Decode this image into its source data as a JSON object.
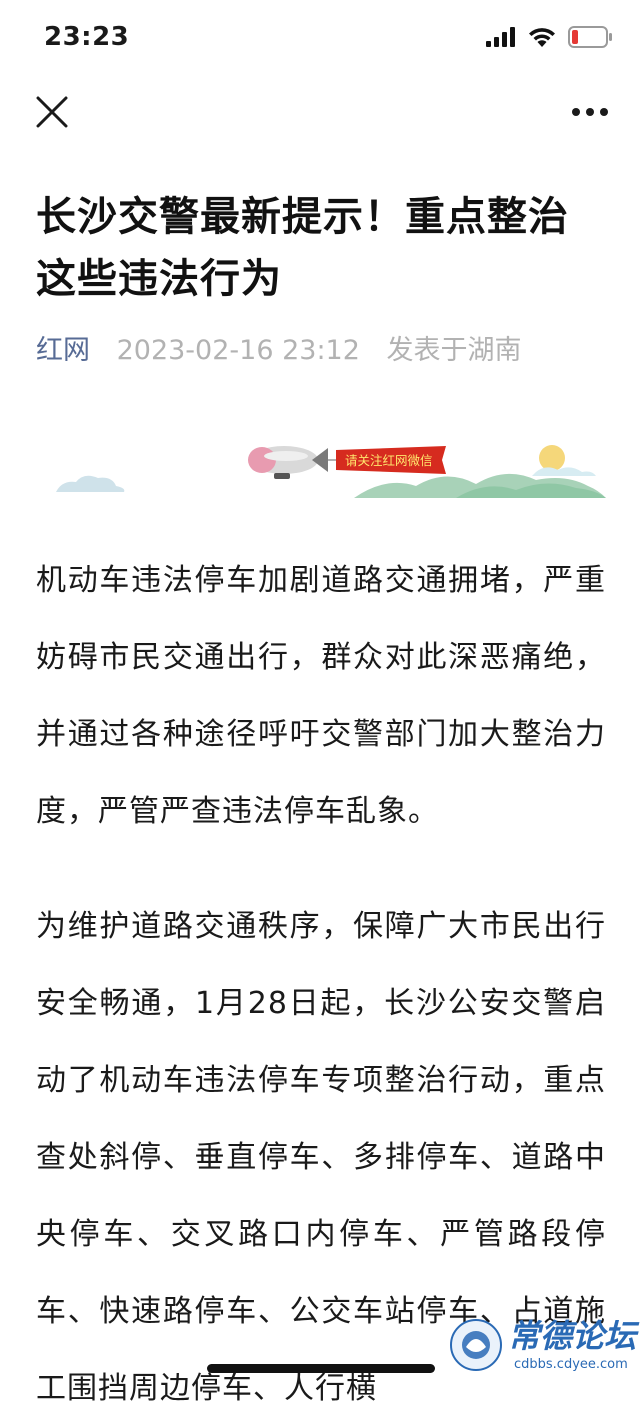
{
  "status_bar": {
    "time": "23:23",
    "battery_level": 0.12
  },
  "nav": {
    "close_icon": "close-icon",
    "more_icon": "more-icon"
  },
  "article": {
    "title": "长沙交警最新提示！重点整治这些违法行为",
    "source": "红网",
    "datetime": "2023-02-16 23:12",
    "location": "发表于湖南",
    "banner_text": "请关注红网微信",
    "paragraphs": [
      "机动车违法停车加剧道路交通拥堵，严重妨碍市民交通出行，群众对此深恶痛绝，并通过各种途径呼吁交警部门加大整治力度，严管严查违法停车乱象。",
      "为维护道路交通秩序，保障广大市民出行安全畅通，1月28日起，长沙公安交警启动了机动车违法停车专项整治行动，重点查处斜停、垂直停车、多排停车、道路中央停车、交叉路口内停车、严管路段停车、快速路停车、公交车站停车、占道施工围挡周边停车、人行横"
    ]
  },
  "watermark": {
    "text": "常德论坛",
    "url": "cdbbs.cdyee.com"
  },
  "colors": {
    "link": "#576b95",
    "meta": "#b2b2b2",
    "banner_red": "#d62b1f"
  }
}
